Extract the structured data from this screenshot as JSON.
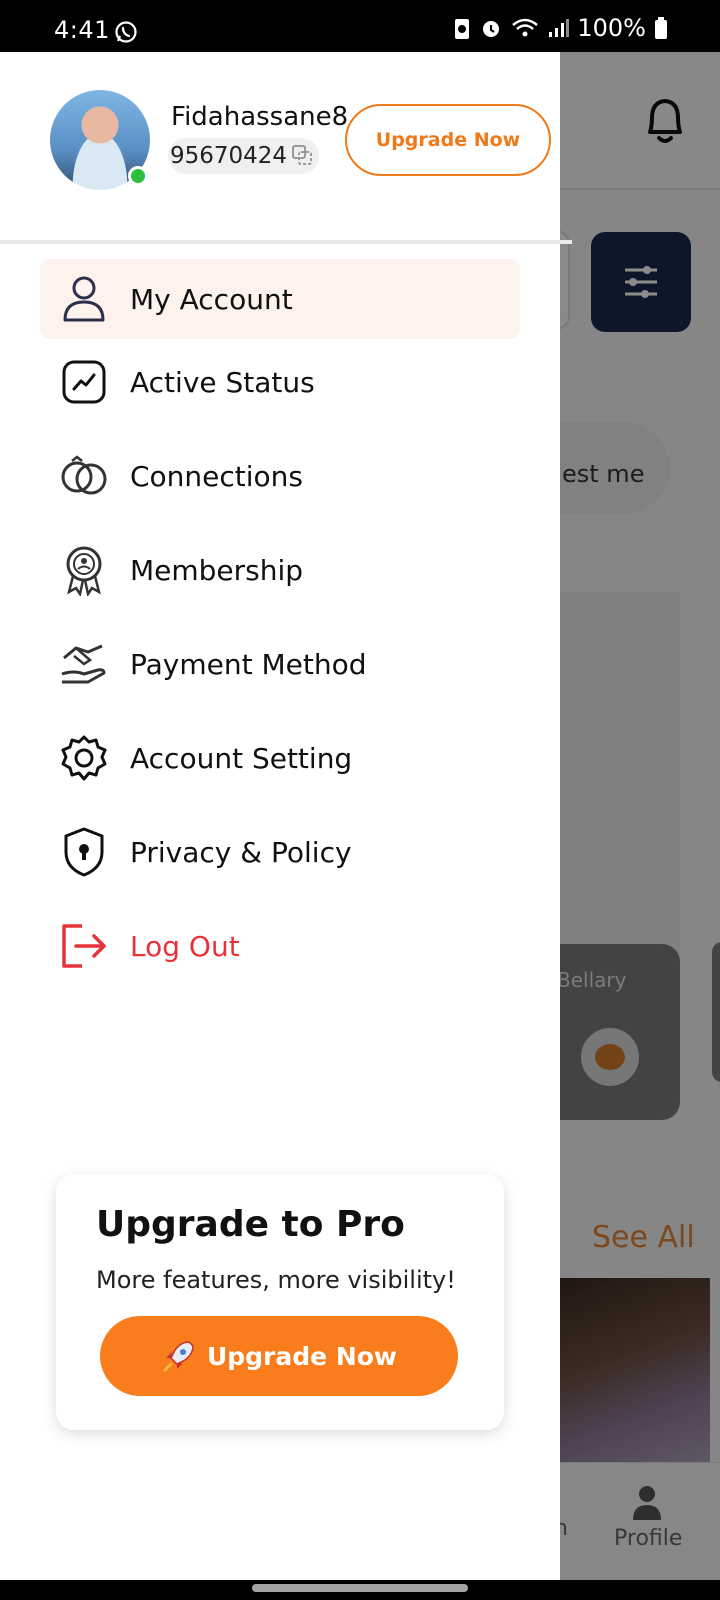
{
  "status_bar": {
    "time": "4:41",
    "battery": "100%"
  },
  "background": {
    "search_partial": "est me",
    "card_city": "Bellary",
    "see_all": "See All",
    "nav_partial": "n",
    "nav_profile": "Profile"
  },
  "profile": {
    "name": "Fidahassane8",
    "id": "95670424",
    "upgrade_label": "Upgrade Now",
    "online": true
  },
  "menu": {
    "items": [
      {
        "label": "My Account",
        "icon": "user-icon",
        "active": true
      },
      {
        "label": "Active Status",
        "icon": "activity-icon"
      },
      {
        "label": "Connections",
        "icon": "rings-icon"
      },
      {
        "label": "Membership",
        "icon": "badge-icon"
      },
      {
        "label": "Payment Method",
        "icon": "handshake-icon"
      },
      {
        "label": "Account Setting",
        "icon": "gear-icon"
      },
      {
        "label": "Privacy & Policy",
        "icon": "shield-lock-icon"
      },
      {
        "label": "Log Out",
        "icon": "logout-icon",
        "danger": true
      }
    ]
  },
  "promo": {
    "title": "Upgrade to Pro",
    "subtitle": "More features, more visibility!",
    "button_label": "Upgrade Now",
    "button_icon": "rocket-icon"
  },
  "colors": {
    "accent": "#f97d1d",
    "danger": "#e8323a",
    "filter_bg": "#1b2a4e",
    "online": "#2fbf3a"
  }
}
